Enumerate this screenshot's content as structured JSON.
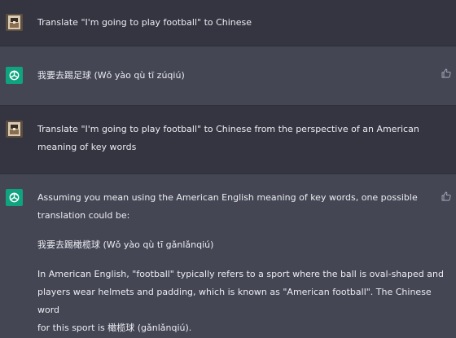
{
  "conversation": {
    "messages": [
      {
        "role": "user",
        "lines": [
          "Translate \"I'm going to play football\" to Chinese"
        ]
      },
      {
        "role": "assistant",
        "lines": [
          "我要去踢足球 (Wǒ yào qù tī zúqiú)"
        ]
      },
      {
        "role": "user",
        "lines": [
          "Translate \"I'm going to play football\" to Chinese from the perspective of an American",
          "meaning of key words"
        ]
      },
      {
        "role": "assistant",
        "paragraphs": [
          [
            "Assuming you mean using the American English meaning of key words, one possible",
            "translation could be:"
          ],
          [
            "我要去踢橄榄球 (Wǒ yào qù tī gǎnlǎnqiú)"
          ],
          [
            "In American English, \"football\" typically refers to a sport where the ball is oval-shaped and",
            "players wear helmets and padding, which is known as \"American football\". The Chinese word",
            "for this sport is 橄榄球 (gǎnlǎnqiú)."
          ]
        ]
      }
    ]
  },
  "icons": {
    "user_avatar": "user-avatar-icon",
    "assistant_avatar": "openai-logo-icon",
    "feedback": "thumbs-up-icon"
  },
  "colors": {
    "user_bg": "#343541",
    "assistant_bg": "#444654",
    "assistant_avatar": "#10a37f",
    "text": "#ececf1"
  }
}
